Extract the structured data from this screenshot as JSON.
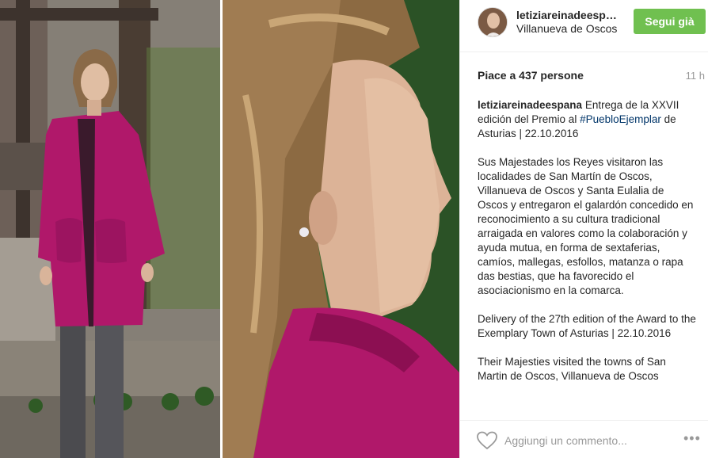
{
  "post": {
    "photo_alt": "Queen in magenta coat at Asturias ceremony",
    "author": {
      "username": "letiziareinadeespana",
      "location": "Villanueva de Oscos"
    },
    "follow_label": "Segui già",
    "likes_text": "Piace a 437 persone",
    "time_ago": "11 h",
    "caption": {
      "username": "letiziareinadeespana",
      "intro_before": "Entrega de la XXVII edición del Premio al",
      "hashtag": "#PuebloEjemplar",
      "intro_after": "de Asturias | 22.10.2016",
      "paragraphs": [
        "Sus Majestades los Reyes visitaron las localidades de San Martín de Oscos, Villanueva de Oscos y Santa Eulalia de Oscos y entregaron el galardón concedido en reconocimiento a su cultura tradicional arraigada en valores como la colaboración y ayuda mutua, en forma de sextaferias, camíos, mallegas, esfollos, matanza o rapa das bestias, que ha favorecido el asociacionismo en la comarca.",
        "Delivery of the 27th edition of the Award to the Exemplary Town of Asturias | 22.10.2016",
        "Their Majesties visited the towns of San Martin de Oscos, Villanueva de Oscos"
      ]
    },
    "comment_placeholder": "Aggiungi un commento...",
    "more_label": "•••"
  },
  "colors": {
    "follow_button": "#70c050",
    "hashtag": "#003569",
    "coat": "#b0186a"
  },
  "icons": {
    "like": "heart-outline-icon",
    "options": "more-dots-icon"
  }
}
